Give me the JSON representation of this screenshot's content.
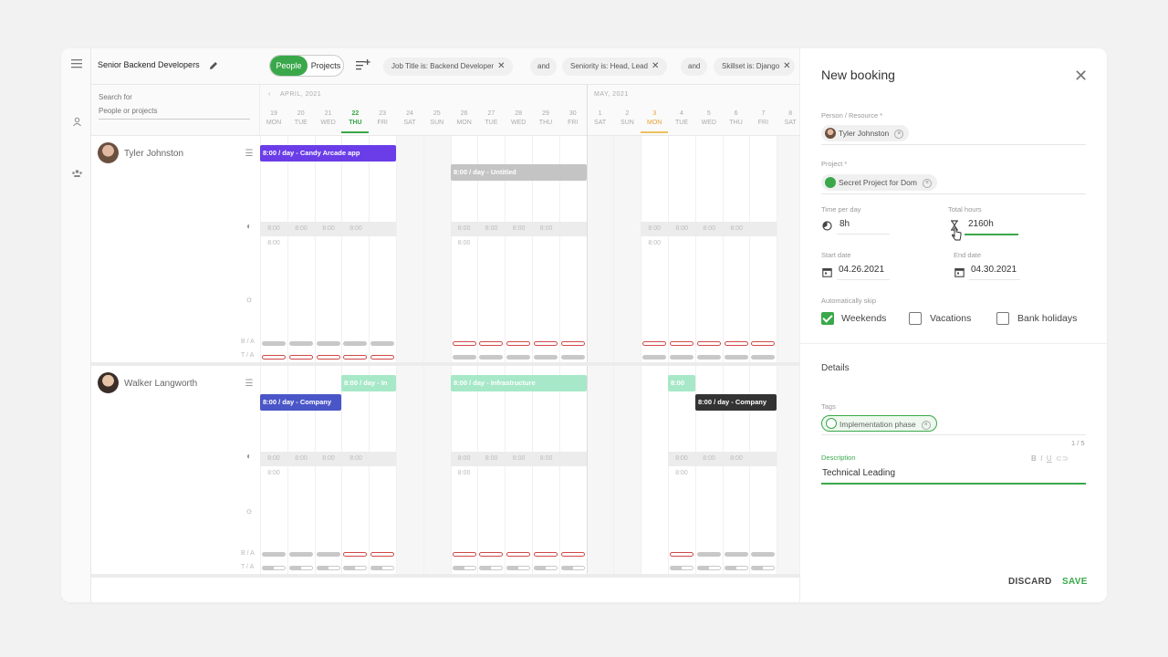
{
  "header": {
    "title": "Senior Backend Developers",
    "toggle": {
      "people": "People",
      "projects": "Projects"
    },
    "filters": [
      {
        "label": "Job Title is: Backend Developer"
      },
      {
        "label": "Seniority is: Head, Lead"
      },
      {
        "label": "Skillset is: Django"
      }
    ],
    "and_label": "and"
  },
  "search": {
    "label": "Search for",
    "placeholder": "People or projects"
  },
  "calendar": {
    "months": [
      "APRIL, 2021",
      "MAY, 2021"
    ],
    "days": [
      {
        "d": "19",
        "w": "MON"
      },
      {
        "d": "20",
        "w": "TUE"
      },
      {
        "d": "21",
        "w": "WED"
      },
      {
        "d": "22",
        "w": "THU"
      },
      {
        "d": "23",
        "w": "FRI"
      },
      {
        "d": "24",
        "w": "SAT"
      },
      {
        "d": "25",
        "w": "SUN"
      },
      {
        "d": "26",
        "w": "MON"
      },
      {
        "d": "27",
        "w": "TUE"
      },
      {
        "d": "28",
        "w": "WED"
      },
      {
        "d": "29",
        "w": "THU"
      },
      {
        "d": "30",
        "w": "FRI"
      },
      {
        "d": "1",
        "w": "SAT"
      },
      {
        "d": "2",
        "w": "SUN"
      },
      {
        "d": "3",
        "w": "MON"
      },
      {
        "d": "4",
        "w": "TUE"
      },
      {
        "d": "5",
        "w": "WED"
      },
      {
        "d": "6",
        "w": "THU"
      },
      {
        "d": "7",
        "w": "FRI"
      },
      {
        "d": "8",
        "w": "SAT"
      }
    ]
  },
  "people": [
    {
      "name": "Tyler Johnston",
      "bookings": [
        "8:00 / day - Candy Arcade app",
        "8:00 / day - Untitled"
      ],
      "hours": "8:00",
      "ba": "B / A",
      "ta": "T / A"
    },
    {
      "name": "Walker Langworth",
      "bookings": [
        "8:00 / day - In",
        "8:00 / day - Infrastructure",
        "8:00",
        "8:00 / day - Company",
        "8:00 / day - Company"
      ],
      "hours": "8:00",
      "ba": "B / A",
      "ta": "T / A"
    }
  ],
  "colors": {
    "accent": "#3aa84a",
    "purple": "#6a3de8",
    "indigo": "#4a56c8",
    "mint": "#a6e8c8",
    "dark": "#333333",
    "gray": "#c4c4c4"
  },
  "booking": {
    "title": "New booking",
    "person_label": "Person / Resource *",
    "person": "Tyler Johnston",
    "project_label": "Project *",
    "project": "Secret Project for Dom",
    "time_per_day_label": "Time per day",
    "time_per_day": "8h",
    "total_hours_label": "Total hours",
    "total_hours": "2160h",
    "start_date_label": "Start date",
    "start_date": "04.26.2021",
    "end_date_label": "End date",
    "end_date": "04.30.2021",
    "skip_label": "Automatically skip",
    "skip": [
      {
        "label": "Weekends",
        "checked": true
      },
      {
        "label": "Vacations",
        "checked": false
      },
      {
        "label": "Bank holidays",
        "checked": false
      }
    ],
    "details_label": "Details",
    "tags_label": "Tags",
    "tag": "Implementation phase",
    "tag_count": "1 / 5",
    "description_label": "Description",
    "description": "Technical Leading",
    "discard": "DISCARD",
    "save": "SAVE"
  }
}
